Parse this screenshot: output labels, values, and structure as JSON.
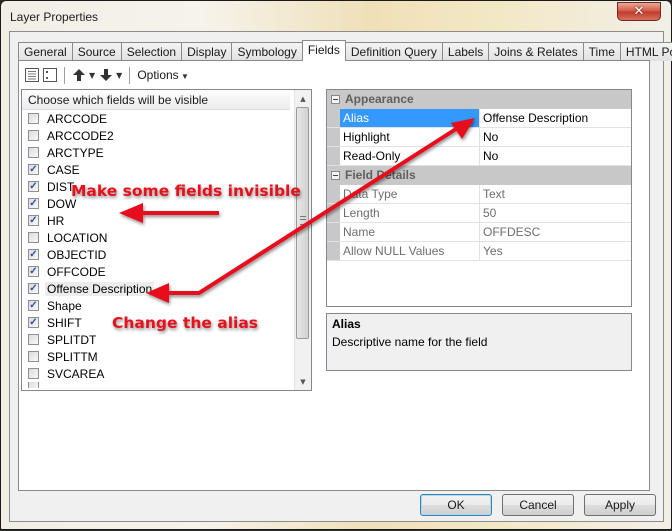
{
  "window": {
    "title": "Layer Properties",
    "close_glyph": "✕"
  },
  "tabs": [
    {
      "label": "General",
      "active": false
    },
    {
      "label": "Source",
      "active": false
    },
    {
      "label": "Selection",
      "active": false
    },
    {
      "label": "Display",
      "active": false
    },
    {
      "label": "Symbology",
      "active": false
    },
    {
      "label": "Fields",
      "active": true
    },
    {
      "label": "Definition Query",
      "active": false
    },
    {
      "label": "Labels",
      "active": false
    },
    {
      "label": "Joins & Relates",
      "active": false
    },
    {
      "label": "Time",
      "active": false
    },
    {
      "label": "HTML Popup",
      "active": false
    }
  ],
  "toolbar": {
    "options_label": "Options",
    "icons": [
      "table-view-icon",
      "list-view-icon",
      "move-up-icon",
      "move-down-icon"
    ]
  },
  "field_list": {
    "header": "Choose which fields will be visible",
    "items": [
      {
        "label": "ARCCODE",
        "checked": false
      },
      {
        "label": "ARCCODE2",
        "checked": false
      },
      {
        "label": "ARCTYPE",
        "checked": false
      },
      {
        "label": "CASE",
        "checked": true
      },
      {
        "label": "DIST",
        "checked": true
      },
      {
        "label": "DOW",
        "checked": true
      },
      {
        "label": "HR",
        "checked": true
      },
      {
        "label": "LOCATION",
        "checked": false
      },
      {
        "label": "OBJECTID",
        "checked": true
      },
      {
        "label": "OFFCODE",
        "checked": true
      },
      {
        "label": "Offense Description",
        "checked": true,
        "selected": true
      },
      {
        "label": "Shape",
        "checked": true
      },
      {
        "label": "SHIFT",
        "checked": true
      },
      {
        "label": "SPLITDT",
        "checked": false
      },
      {
        "label": "SPLITTM",
        "checked": false
      },
      {
        "label": "SVCAREA",
        "checked": false
      }
    ]
  },
  "properties": {
    "categories": [
      {
        "name": "Appearance",
        "rows": [
          {
            "name": "Alias",
            "value": "Offense Description",
            "selected": true,
            "readonly": false
          },
          {
            "name": "Highlight",
            "value": "No",
            "selected": false,
            "readonly": false
          },
          {
            "name": "Read-Only",
            "value": "No",
            "selected": false,
            "readonly": false
          }
        ]
      },
      {
        "name": "Field Details",
        "rows": [
          {
            "name": "Data Type",
            "value": "Text",
            "selected": false,
            "readonly": true
          },
          {
            "name": "Length",
            "value": "50",
            "selected": false,
            "readonly": true
          },
          {
            "name": "Name",
            "value": "OFFDESC",
            "selected": false,
            "readonly": true
          },
          {
            "name": "Allow NULL Values",
            "value": "Yes",
            "selected": false,
            "readonly": true
          }
        ]
      }
    ]
  },
  "description": {
    "title": "Alias",
    "text": "Descriptive name for the field"
  },
  "buttons": {
    "ok": "OK",
    "cancel": "Cancel",
    "apply": "Apply"
  },
  "annotations": {
    "invisible": "Make some fields invisible",
    "alias": "Change the alias",
    "color": "#e8101a"
  }
}
